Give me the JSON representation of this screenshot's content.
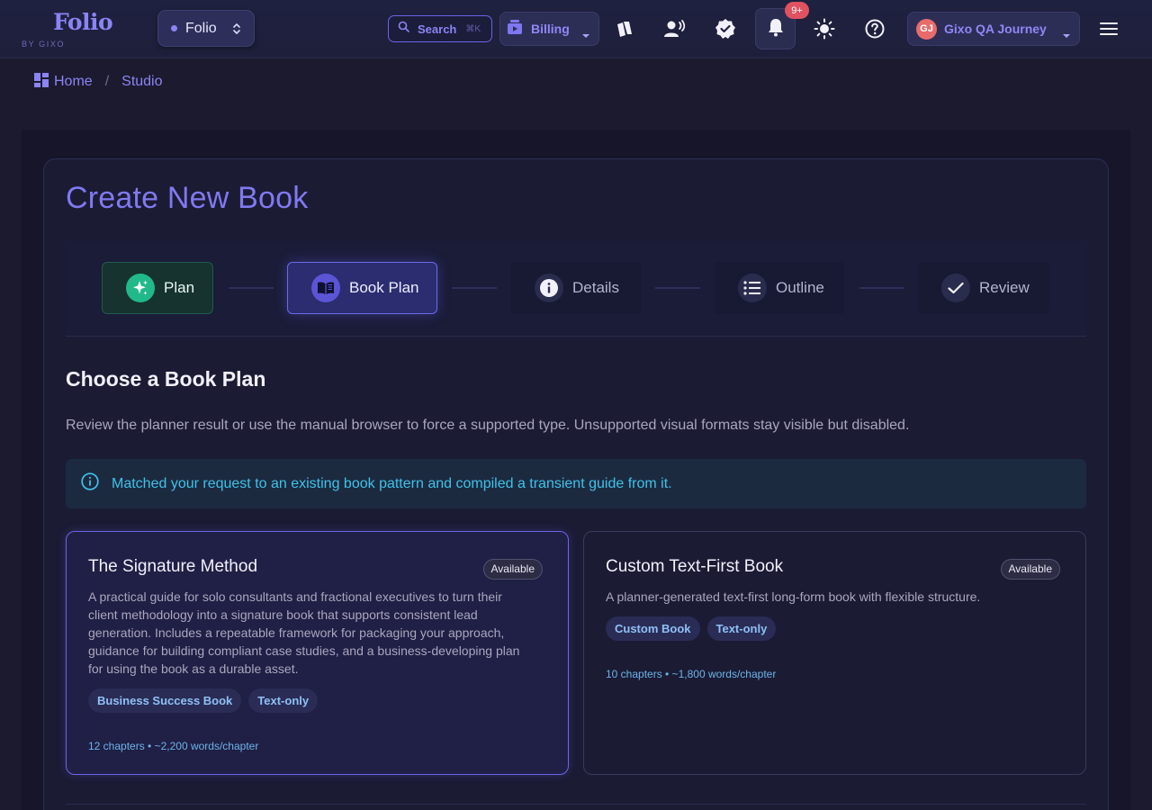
{
  "topbar": {
    "logo_word": "Folio",
    "logo_sub": "BY GIXO",
    "workspace_label": "Folio",
    "search_label": "Search",
    "search_shortcut": "⌘K",
    "billing_label": "Billing",
    "notifications_badge": "9+",
    "user_initials": "GJ",
    "user_label": "Gixo QA Journey",
    "icons": [
      "cards-icon",
      "speaking-user-icon",
      "verified-badge-icon",
      "bell-icon",
      "sun-icon",
      "help-icon",
      "menu-icon"
    ]
  },
  "breadcrumb": {
    "home": "Home",
    "separator": "/",
    "current": "Studio"
  },
  "page": {
    "title": "Create New Book"
  },
  "stepper": {
    "steps": [
      {
        "label": "Plan",
        "state": "complete"
      },
      {
        "label": "Book Plan",
        "state": "active"
      },
      {
        "label": "Details",
        "state": "upcoming"
      },
      {
        "label": "Outline",
        "state": "upcoming"
      },
      {
        "label": "Review",
        "state": "upcoming"
      }
    ]
  },
  "section": {
    "title": "Choose a Book Plan",
    "description": "Review the planner result or use the manual browser to force a supported type. Unsupported visual formats stay visible but disabled.",
    "info": "Matched your request to an existing book pattern and compiled a transient guide from it."
  },
  "plans": [
    {
      "title": "The Signature Method",
      "badge": "Available",
      "description": "A practical guide for solo consultants and fractional executives to turn their client methodology into a signature book that supports consistent lead generation. Includes a repeatable framework for packaging your approach, guidance for building compliant case studies, and a business-developing plan for using the book as a durable asset.",
      "chips": [
        "Business Success Book",
        "Text-only"
      ],
      "meta": "12 chapters • ~2,200 words/chapter",
      "selected": true
    },
    {
      "title": "Custom Text-First Book",
      "badge": "Available",
      "description": "A planner-generated text-first long-form book with flexible structure.",
      "chips": [
        "Custom Book",
        "Text-only"
      ],
      "meta": "10 chapters • ~1,800 words/chapter",
      "selected": false
    }
  ],
  "colors": {
    "accent": "#8079f0",
    "success": "#21b98a",
    "info": "#3fc2e8",
    "badge_red": "#e05260"
  }
}
